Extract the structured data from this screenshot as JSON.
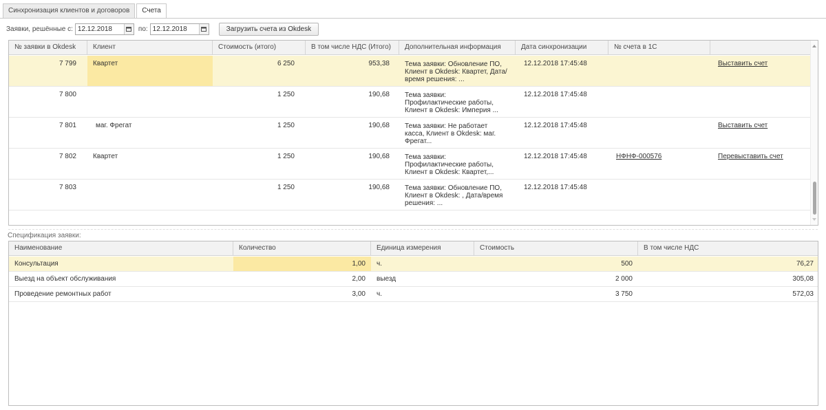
{
  "tabs": [
    {
      "label": "Синхронизация клиентов и договоров",
      "active": false
    },
    {
      "label": "Счета",
      "active": true
    }
  ],
  "filter": {
    "from_label": "Заявки, решённые с:",
    "from_value": "12.12.2018",
    "to_label": "по:",
    "to_value": "12.12.2018",
    "load_button": "Загрузить счета из Okdesk"
  },
  "invoices": {
    "columns": [
      "№ заявки в Okdesk",
      "Клиент",
      "Стоимость (итого)",
      "В том числе НДС (Итого)",
      "Дополнительная информация",
      "Дата синхронизации",
      "№ счета в 1С",
      ""
    ],
    "rows": [
      {
        "id": "7 799",
        "client": "Квартет",
        "cost": "6 250",
        "vat": "953,38",
        "info": "Тема заявки: Обновление ПО, Клиент в Okdesk: Квартет, Дата/время решения: ...",
        "sync": "12.12.2018 17:45:48",
        "invoice": "",
        "action": "Выставить счет"
      },
      {
        "id": "7 800",
        "client": "",
        "cost": "1 250",
        "vat": "190,68",
        "info": "Тема заявки: Профилактические работы, Клиент в Okdesk: Империя ...",
        "sync": "12.12.2018 17:45:48",
        "invoice": "",
        "action": ""
      },
      {
        "id": "7 801",
        "client": "маг. Фрегат",
        "cost": "1 250",
        "vat": "190,68",
        "info": "Тема заявки: Не работает касса, Клиент в Okdesk: маг. Фрегат...",
        "sync": "12.12.2018 17:45:48",
        "invoice": "",
        "action": "Выставить счет"
      },
      {
        "id": "7 802",
        "client": "Квартет",
        "cost": "1 250",
        "vat": "190,68",
        "info": "Тема заявки: Профилактические работы, Клиент в Okdesk: Квартет,...",
        "sync": "12.12.2018 17:45:48",
        "invoice": "НФНФ-000576",
        "action": "Перевыставить счет"
      },
      {
        "id": "7 803",
        "client": "",
        "cost": "1 250",
        "vat": "190,68",
        "info": "Тема заявки: Обновление ПО, Клиент в Okdesk: , Дата/время решения: ...",
        "sync": "12.12.2018 17:45:48",
        "invoice": "",
        "action": ""
      }
    ]
  },
  "spec": {
    "label": "Спецификация заявки:",
    "columns": [
      "Наименование",
      "Количество",
      "Единица измерения",
      "Стоимость",
      "В том числе НДС"
    ],
    "rows": [
      {
        "name": "Консультация",
        "qty": "1,00",
        "unit": "ч.",
        "cost": "500",
        "vat": "76,27"
      },
      {
        "name": "Выезд на объект обслуживания",
        "qty": "2,00",
        "unit": "выезд",
        "cost": "2 000",
        "vat": "305,08"
      },
      {
        "name": "Проведение ремонтных работ",
        "qty": "3,00",
        "unit": "ч.",
        "cost": "3 750",
        "vat": "572,03"
      }
    ]
  },
  "colors": {
    "selected_row": "#fbf5d2",
    "selected_cell": "#fbe9a3",
    "header_bg": "#f2f2f2"
  }
}
